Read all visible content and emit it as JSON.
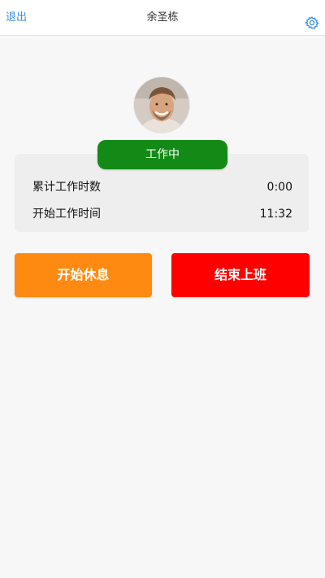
{
  "header": {
    "exit_label": "退出",
    "title": "余圣栋",
    "settings_icon": "gear-icon"
  },
  "profile": {
    "avatar_icon": "user-avatar"
  },
  "status": {
    "label": "工作中",
    "color": "#138a16"
  },
  "stats": {
    "rows": [
      {
        "label": "累计工作时数",
        "value": "0:00"
      },
      {
        "label": "开始工作时间",
        "value": "11:32"
      }
    ]
  },
  "actions": {
    "start_break_label": "开始休息",
    "start_break_color": "#ff8a12",
    "end_shift_label": "结束上班",
    "end_shift_color": "#ff0000"
  }
}
